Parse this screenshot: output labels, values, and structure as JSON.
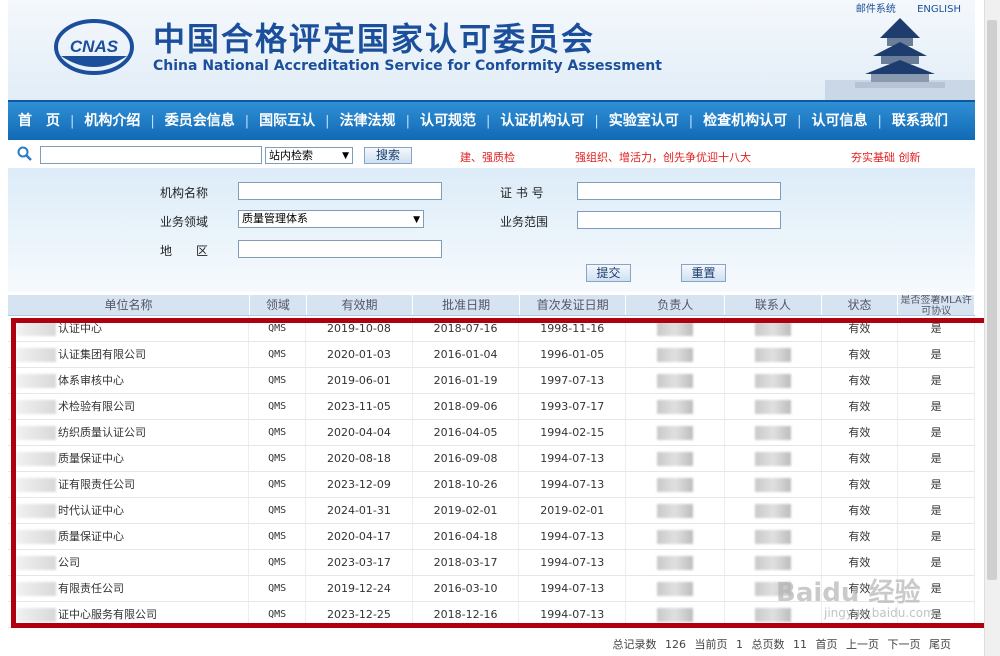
{
  "header": {
    "logo_text": "CNAS",
    "title_cn": "中国合格评定国家认可委员会",
    "title_en": "China National Accreditation Service for Conformity Assessment",
    "links": [
      "邮件系统",
      "ENGLISH"
    ]
  },
  "nav": [
    "首　页",
    "机构介绍",
    "委员会信息",
    "国际互认",
    "法律法规",
    "认可规范",
    "认证机构认可",
    "实验室认可",
    "检查机构认可",
    "认可信息",
    "联系我们"
  ],
  "search": {
    "scope": "站内检索",
    "button": "搜索",
    "slogans": [
      "建、强质检",
      "强组织、增活力，创先争优迎十八大",
      "夯实基础 创新"
    ]
  },
  "form": {
    "org_name_label": "机构名称",
    "cert_no_label": "证 书 号",
    "domain_label": "业务领域",
    "domain_value": "质量管理体系",
    "scope_label": "业务范围",
    "region_label": "地　　区",
    "submit": "提交",
    "reset": "重置"
  },
  "table": {
    "headers": [
      "单位名称",
      "领域",
      "有效期",
      "批准日期",
      "首次发证日期",
      "负责人",
      "联系人",
      "状态",
      "是否签署MLA许可协议"
    ],
    "rows": [
      {
        "name": "认证中心",
        "domain": "QMS",
        "expiry": "2019-10-08",
        "approved": "2018-07-16",
        "first": "1998-11-16",
        "status": "有效",
        "mla": "是"
      },
      {
        "name": "认证集团有限公司",
        "domain": "QMS",
        "expiry": "2020-01-03",
        "approved": "2016-01-04",
        "first": "1996-01-05",
        "status": "有效",
        "mla": "是"
      },
      {
        "name": "体系审核中心",
        "domain": "QMS",
        "expiry": "2019-06-01",
        "approved": "2016-01-19",
        "first": "1997-07-13",
        "status": "有效",
        "mla": "是"
      },
      {
        "name": "术检验有限公司",
        "domain": "QMS",
        "expiry": "2023-11-05",
        "approved": "2018-09-06",
        "first": "1993-07-17",
        "status": "有效",
        "mla": "是"
      },
      {
        "name": "纺织质量认证公司",
        "domain": "QMS",
        "expiry": "2020-04-04",
        "approved": "2016-04-05",
        "first": "1994-02-15",
        "status": "有效",
        "mla": "是"
      },
      {
        "name": "质量保证中心",
        "domain": "QMS",
        "expiry": "2020-08-18",
        "approved": "2016-09-08",
        "first": "1994-07-13",
        "status": "有效",
        "mla": "是"
      },
      {
        "name": "证有限责任公司",
        "domain": "QMS",
        "expiry": "2023-12-09",
        "approved": "2018-10-26",
        "first": "1994-07-13",
        "status": "有效",
        "mla": "是"
      },
      {
        "name": "时代认证中心",
        "domain": "QMS",
        "expiry": "2024-01-31",
        "approved": "2019-02-01",
        "first": "2019-02-01",
        "status": "有效",
        "mla": "是"
      },
      {
        "name": "质量保证中心",
        "domain": "QMS",
        "expiry": "2020-04-17",
        "approved": "2016-04-18",
        "first": "1994-07-13",
        "status": "有效",
        "mla": "是"
      },
      {
        "name": "公司",
        "domain": "QMS",
        "expiry": "2023-03-17",
        "approved": "2018-03-17",
        "first": "1994-07-13",
        "status": "有效",
        "mla": "是"
      },
      {
        "name": "有限责任公司",
        "domain": "QMS",
        "expiry": "2019-12-24",
        "approved": "2016-03-10",
        "first": "1994-07-13",
        "status": "有效",
        "mla": "是"
      },
      {
        "name": "证中心服务有限公司",
        "domain": "QMS",
        "expiry": "2023-12-25",
        "approved": "2018-12-16",
        "first": "1994-07-13",
        "status": "有效",
        "mla": "是"
      }
    ]
  },
  "footer": {
    "total_label": "总记录数",
    "total": "126",
    "current_label": "当前页",
    "current": "1",
    "pages_label": "总页数",
    "pages": "11",
    "first": "首页",
    "prev": "上一页",
    "next": "下一页",
    "last": "尾页"
  },
  "watermark": "Baidu 经验",
  "watermark_url": "jingyan.baidu.com"
}
